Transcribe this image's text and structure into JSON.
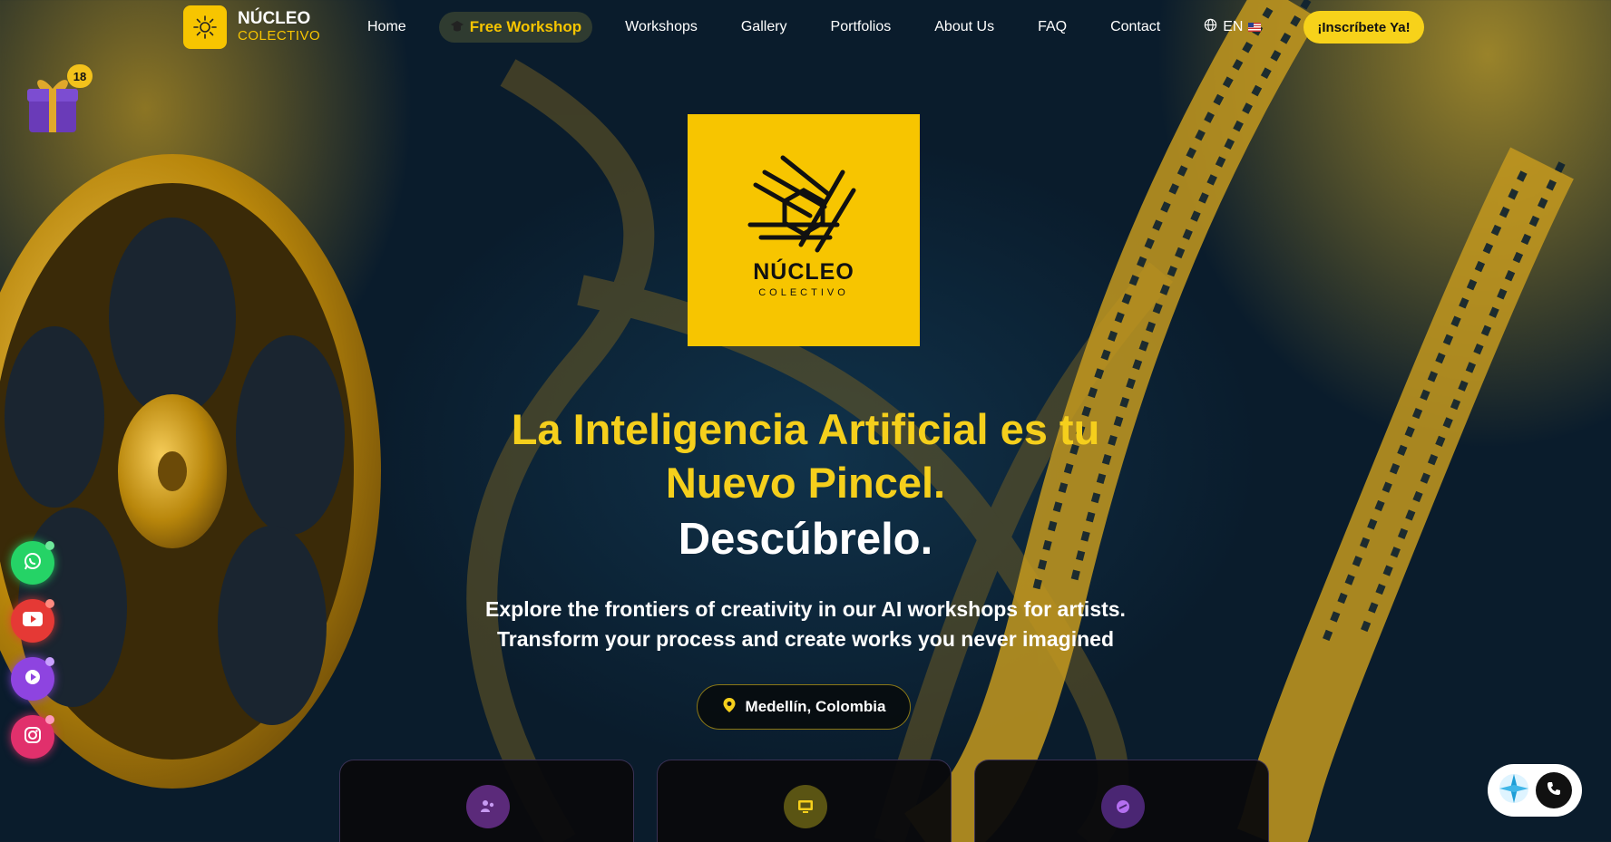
{
  "brand": {
    "name": "NÚCLEO",
    "sub": "COLECTIVO"
  },
  "nav": {
    "home": "Home",
    "free_workshop": "Free Workshop",
    "workshops": "Workshops",
    "gallery": "Gallery",
    "portfolios": "Portfolios",
    "about": "About Us",
    "faq": "FAQ",
    "contact": "Contact",
    "language": "EN",
    "cta": "¡Inscríbete Ya!"
  },
  "gift": {
    "count": "18"
  },
  "hero": {
    "logo_line1": "NÚCLEO",
    "logo_line2": "COLECTIVO",
    "headline_1": "La Inteligencia Artificial es tu",
    "headline_2": "Nuevo Pincel.",
    "subhead": "Descúbrelo.",
    "desc_1": "Explore the frontiers of creativity in our AI workshops for artists.",
    "desc_2": "Transform your process and create works you never imagined",
    "location": "Medellín, Colombia"
  },
  "cards": [
    {
      "icon": "people-icon",
      "color": "#5b2a7a"
    },
    {
      "icon": "monitor-icon",
      "color": "#5a5413"
    },
    {
      "icon": "palette-icon",
      "color": "#4a2673"
    }
  ],
  "social": [
    {
      "icon": "whatsapp-icon",
      "color": "#25d366"
    },
    {
      "icon": "youtube-icon",
      "color": "#e53935"
    },
    {
      "icon": "play-icon",
      "color": "#8e44e0"
    },
    {
      "icon": "instagram-icon",
      "color": "#e1306c"
    }
  ],
  "colors": {
    "accent": "#f7c500",
    "headline": "#f5cf1c",
    "bg": "#0a1c2c"
  }
}
